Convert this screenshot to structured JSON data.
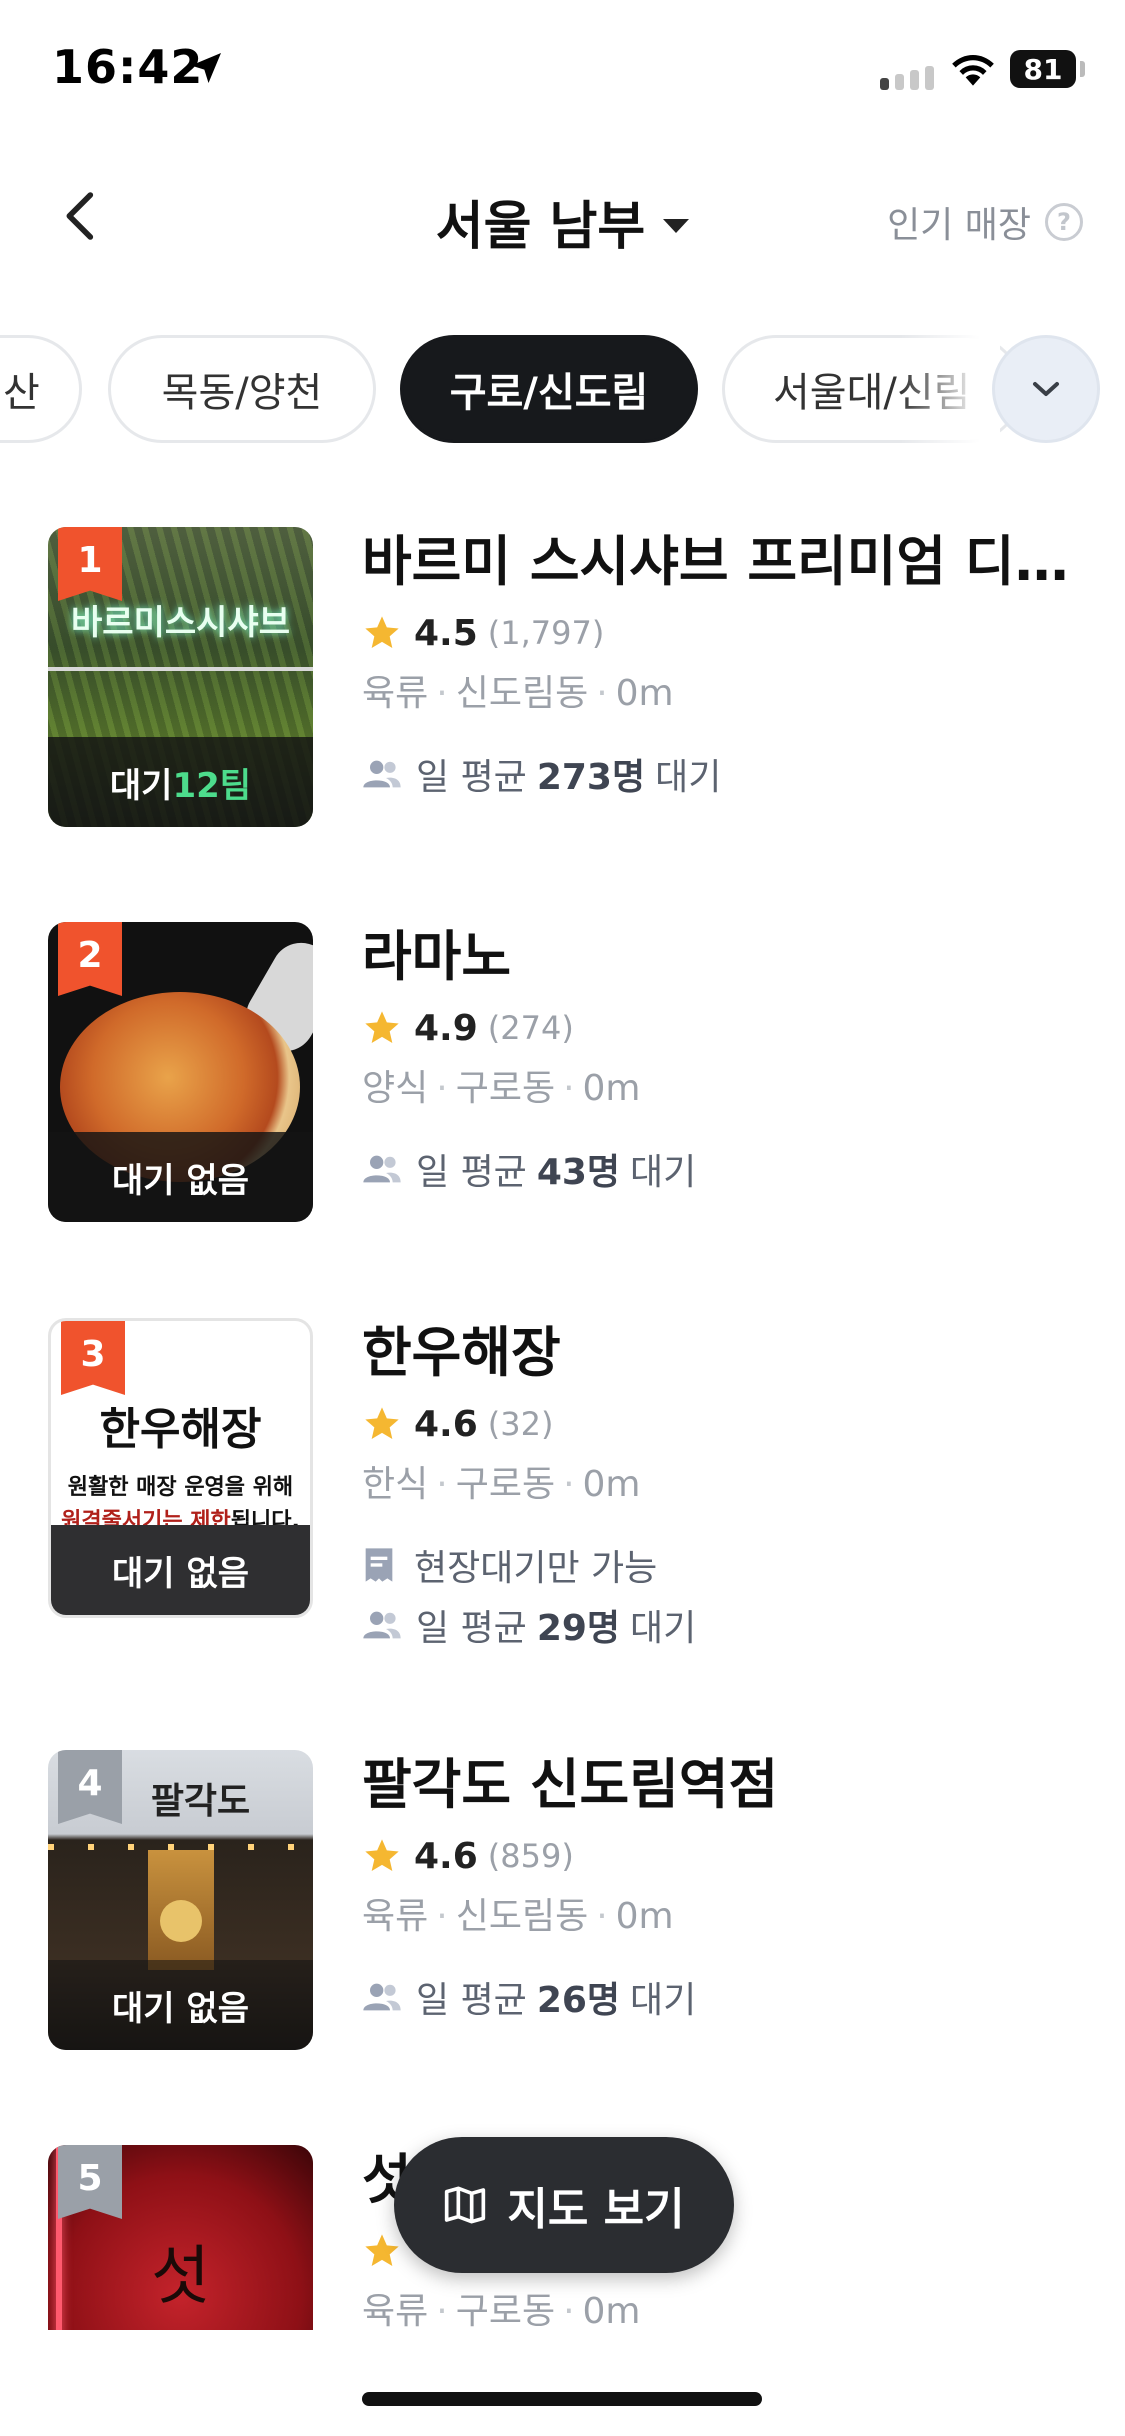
{
  "status_bar": {
    "time": "16:42",
    "battery": "81"
  },
  "header": {
    "title": "서울 남부",
    "popular_label": "인기 매장",
    "help_glyph": "?"
  },
  "chips": [
    {
      "label": "산",
      "active": false
    },
    {
      "label": "목동/양천",
      "active": false
    },
    {
      "label": "구로/신도림",
      "active": true
    },
    {
      "label": "서울대/신림",
      "active": false
    }
  ],
  "stores": [
    {
      "rank": "1",
      "name": "바르미 스시샤브 프리미엄 디큐...",
      "score": "4.5",
      "count": "(1,797)",
      "category": "육류",
      "area": "신도림동",
      "distance": "0m",
      "wait_prefix": "대기",
      "wait_value": "12팀",
      "avg_prefix": "일 평균",
      "avg_value": "273명",
      "avg_suffix": "대기",
      "thumb_text": "바르미스시샤브"
    },
    {
      "rank": "2",
      "name": "라마노",
      "score": "4.9",
      "count": "(274)",
      "category": "양식",
      "area": "구로동",
      "distance": "0m",
      "wait_text": "대기 없음",
      "avg_prefix": "일 평균",
      "avg_value": "43명",
      "avg_suffix": "대기"
    },
    {
      "rank": "3",
      "name": "한우해장",
      "score": "4.6",
      "count": "(32)",
      "category": "한식",
      "area": "구로동",
      "distance": "0m",
      "wait_text": "대기 없음",
      "onsite_label": "현장대기만 가능",
      "avg_prefix": "일 평균",
      "avg_value": "29명",
      "avg_suffix": "대기",
      "thumb_title": "한우해장",
      "thumb_line1": "원활한 매장 운영을 위해",
      "thumb_line2_red": "원격줄서기는 제한",
      "thumb_line2_rest": "됩니다."
    },
    {
      "rank": "4",
      "name": "팔각도 신도림역점",
      "score": "4.6",
      "count": "(859)",
      "category": "육류",
      "area": "신도림동",
      "distance": "0m",
      "wait_text": "대기 없음",
      "avg_prefix": "일 평균",
      "avg_value": "26명",
      "avg_suffix": "대기",
      "thumb_sign": "팔각도"
    },
    {
      "rank": "5",
      "name_partial": "섯",
      "category": "육류",
      "area": "구로동",
      "distance": "0m",
      "thumb_sign": "섯"
    }
  ],
  "map_button": {
    "label": "지도 보기"
  },
  "colors": {
    "accent_rank": "#f0532d",
    "active_chip": "#17191c",
    "wait_green": "#4ddc8c",
    "star": "#f5b731"
  }
}
